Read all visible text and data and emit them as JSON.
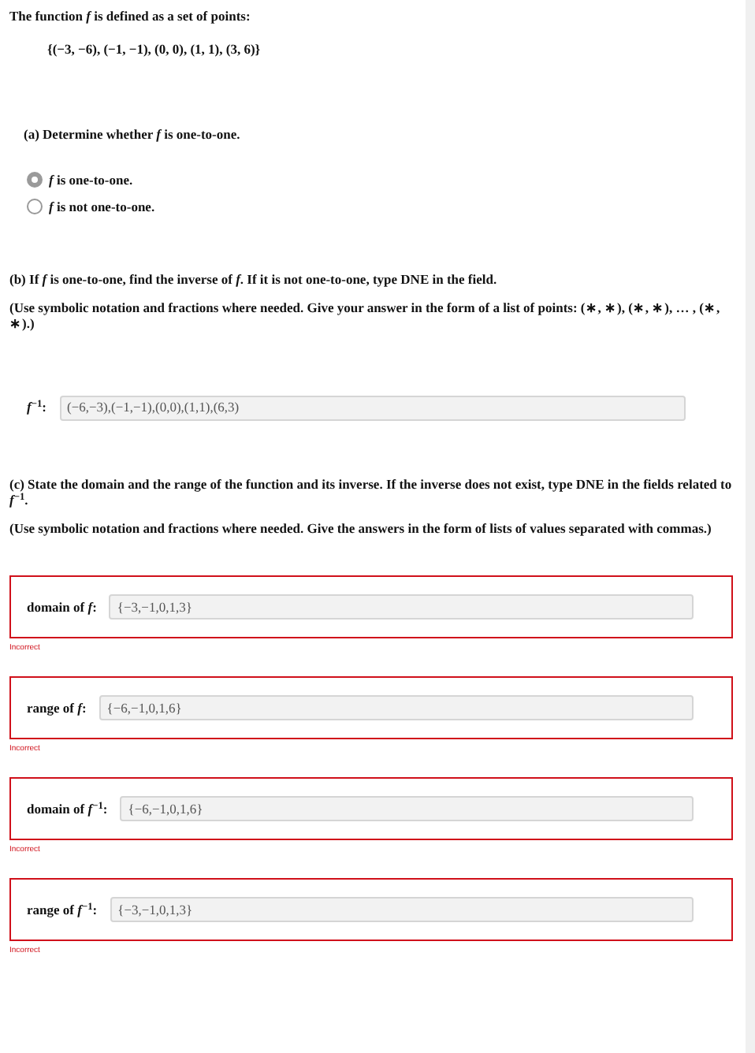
{
  "intro": "The function *f* is defined as a set of points:",
  "point_set": "{(−3, −6), (−1, −1), (0, 0), (1, 1), (3, 6)}",
  "part_a": {
    "prompt": "(a) Determine whether *f* is one-to-one.",
    "options": [
      {
        "label": "*f* is one-to-one.",
        "selected": true
      },
      {
        "label": "*f* is not one-to-one.",
        "selected": false
      }
    ]
  },
  "part_b": {
    "prompt": "(b) If *f* is one-to-one, find the inverse of *f*. If it is not one-to-one, type DNE in the field.",
    "hint": "(Use symbolic notation and fractions where needed. Give your answer in the form of a list of points: (∗, ∗), (∗, ∗),  … , (∗, ∗).)",
    "field": {
      "label": "*f*$^{−1}$:",
      "value": "(−6,−3),(−1,−1),(0,0),(1,1),(6,3)"
    }
  },
  "part_c": {
    "prompt": "(c) State the domain and the range of the function and its inverse. If the inverse does not exist, type DNE in the fields related to *f*$^{−1}$.",
    "hint": "(Use symbolic notation and fractions where needed. Give the answers in the form of lists of values separated with commas.)",
    "fields": [
      {
        "label": "domain of *f*:",
        "value": "{−3,−1,0,1,3}",
        "incorrect": true,
        "feedback": "Incorrect"
      },
      {
        "label": "range of *f*:",
        "value": "{−6,−1,0,1,6}",
        "incorrect": true,
        "feedback": "Incorrect"
      },
      {
        "label": "domain of *f*$^{−1}$:",
        "value": "{−6,−1,0,1,6}",
        "incorrect": true,
        "feedback": "Incorrect"
      },
      {
        "label": "range of *f*$^{−1}$:",
        "value": "{−3,−1,0,1,3}",
        "incorrect": true,
        "feedback": "Incorrect"
      }
    ]
  }
}
